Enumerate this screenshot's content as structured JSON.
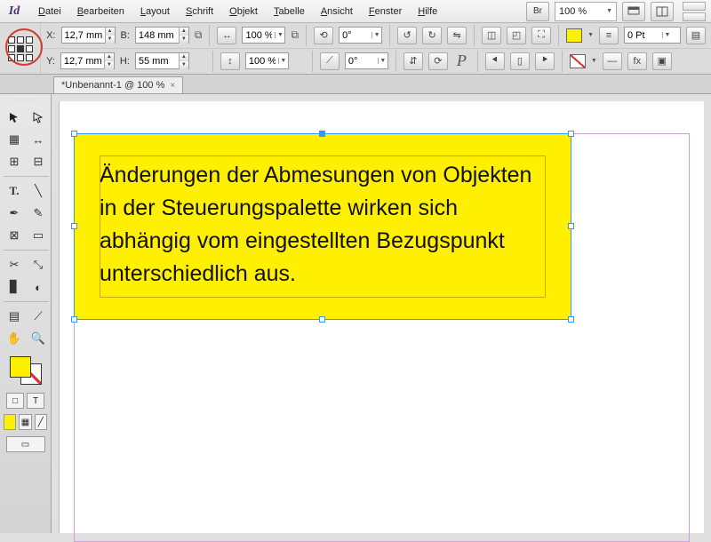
{
  "app": {
    "logo_text": "Id"
  },
  "menus": {
    "items": [
      {
        "key": "D",
        "rest": "atei"
      },
      {
        "key": "B",
        "rest": "earbeiten"
      },
      {
        "key": "L",
        "rest": "ayout"
      },
      {
        "key": "S",
        "rest": "chrift"
      },
      {
        "key": "O",
        "rest": "bjekt"
      },
      {
        "key": "T",
        "rest": "abelle"
      },
      {
        "key": "A",
        "rest": "nsicht"
      },
      {
        "key": "F",
        "rest": "enster"
      },
      {
        "key": "H",
        "rest": "ilfe"
      }
    ]
  },
  "top_right": {
    "br_label": "Br",
    "zoom": "100 %"
  },
  "control": {
    "x_value": "12,7 mm",
    "y_value": "12,7 mm",
    "b_label": "B:",
    "b_value": "148 mm",
    "h_label": "H:",
    "h_value": "55 mm",
    "scale_x": "100 %",
    "scale_y": "100 %",
    "rotate": "0°",
    "shear": "0°",
    "stroke_weight": "0 Pt",
    "reference_point_selected": "center"
  },
  "tabs": {
    "doc": "*Unbenannt-1 @ 100 %"
  },
  "textframe": {
    "content": "Änderungen der Abmesungen von Objekten in der Steuerungspalette wirken sich abhängig vom eingestell­ten Bezugspunkt unterschiedlich aus."
  },
  "colors": {
    "fill": "#ffef00",
    "accent_red": "#d43a2f",
    "selection": "#3399ff"
  }
}
